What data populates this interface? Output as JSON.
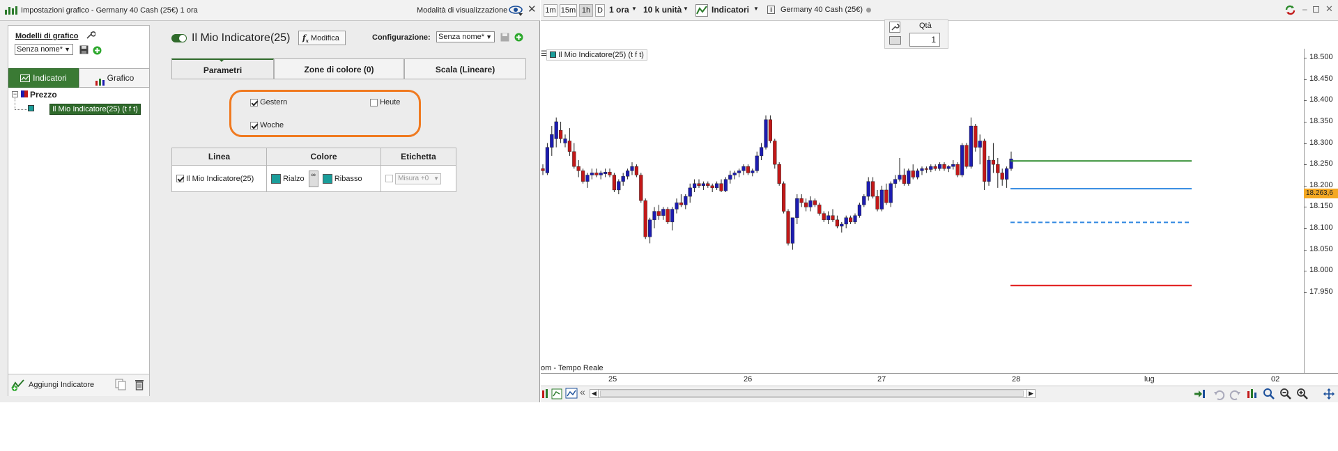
{
  "dialog": {
    "title": "Impostazioni grafico - Germany 40 Cash (25€) 1 ora",
    "view_mode_label": "Modalità di visualizzazione",
    "chart_models_label": "Modelli di grafico",
    "model_select_value": "Senza nome*",
    "left_tabs": {
      "indicators": "Indicatori",
      "chart": "Grafico"
    },
    "tree": {
      "root": "Prezzo",
      "child": "Il Mio Indicatore(25) (t f t)"
    },
    "add_indicator_label": "Aggiungi Indicatore",
    "indicator_title": "Il Mio Indicatore(25)",
    "edit_label": "Modifica",
    "configuration_label": "Configurazione:",
    "configuration_value": "Senza nome*",
    "param_tabs": [
      "Parametri",
      "Zone di colore (0)",
      "Scala (Lineare)"
    ],
    "params": [
      {
        "label": "Gestern",
        "checked": true
      },
      {
        "label": "Heute",
        "checked": false
      },
      {
        "label": "Woche",
        "checked": true
      }
    ],
    "line_table": {
      "headers": [
        "Linea",
        "Colore",
        "Etichetta"
      ],
      "row": {
        "line_label": "Il Mio Indicatore(25)",
        "line_checked": true,
        "up_label": "Rialzo",
        "down_label": "Ribasso",
        "label_select": "Misura +0",
        "label_checked": false
      }
    },
    "highlight_color": "#f07a20"
  },
  "chart": {
    "timeframes": [
      "1m",
      "15m",
      "1h",
      "D"
    ],
    "selected_timeframe": "1h",
    "period_label": "1 ora",
    "units_label": "10 k unità",
    "indicators_label": "Indicatori",
    "instrument": "Germany 40 Cash (25€)",
    "qty_label": "Qtà",
    "qty_value": "1",
    "legend_label": "Il Mio Indicatore(25) (t f t)",
    "source_text": "om - Tempo Reale",
    "price_labels": [
      "18.500",
      "18.450",
      "18.400",
      "18.350",
      "18.300",
      "18.250",
      "18.200",
      "18.150",
      "18.100",
      "18.050",
      "18.000",
      "17.950"
    ],
    "current_price": "18.263,6",
    "date_labels": [
      "25",
      "26",
      "27",
      "28",
      "lug",
      "02"
    ],
    "colors": {
      "up": "#1c1cb0",
      "down": "#c21818",
      "level_green": "#2e8b2e",
      "level_blue": "#2d86e0",
      "level_red": "#e01515",
      "price_tag": "#f4a823"
    }
  },
  "chart_data": {
    "type": "candlestick",
    "title": "",
    "xlabel": "",
    "ylabel": "",
    "ylim": [
      17930,
      18520
    ],
    "candles": [
      [
        18240,
        18250,
        18225,
        18235
      ],
      [
        18230,
        18300,
        18225,
        18290
      ],
      [
        18290,
        18340,
        18270,
        18320
      ],
      [
        18310,
        18360,
        18290,
        18350
      ],
      [
        18330,
        18350,
        18300,
        18310
      ],
      [
        18300,
        18320,
        18290,
        18310
      ],
      [
        18305,
        18335,
        18270,
        18280
      ],
      [
        18280,
        18300,
        18240,
        18245
      ],
      [
        18245,
        18260,
        18220,
        18235
      ],
      [
        18235,
        18240,
        18205,
        18210
      ],
      [
        18210,
        18230,
        18195,
        18225
      ],
      [
        18225,
        18240,
        18215,
        18230
      ],
      [
        18230,
        18240,
        18220,
        18225
      ],
      [
        18225,
        18235,
        18215,
        18230
      ],
      [
        18228,
        18240,
        18220,
        18232
      ],
      [
        18232,
        18240,
        18220,
        18225
      ],
      [
        18225,
        18230,
        18185,
        18190
      ],
      [
        18190,
        18215,
        18180,
        18210
      ],
      [
        18210,
        18230,
        18200,
        18222
      ],
      [
        18222,
        18240,
        18215,
        18235
      ],
      [
        18235,
        18255,
        18225,
        18245
      ],
      [
        18245,
        18250,
        18220,
        18225
      ],
      [
        18225,
        18230,
        18160,
        18165
      ],
      [
        18165,
        18170,
        18075,
        18080
      ],
      [
        18080,
        18125,
        18065,
        18120
      ],
      [
        18120,
        18150,
        18100,
        18140
      ],
      [
        18140,
        18155,
        18120,
        18130
      ],
      [
        18130,
        18150,
        18120,
        18145
      ],
      [
        18145,
        18150,
        18110,
        18115
      ],
      [
        18115,
        18150,
        18095,
        18145
      ],
      [
        18145,
        18170,
        18135,
        18160
      ],
      [
        18160,
        18180,
        18150,
        18155
      ],
      [
        18155,
        18180,
        18145,
        18175
      ],
      [
        18175,
        18205,
        18160,
        18195
      ],
      [
        18195,
        18215,
        18185,
        18205
      ],
      [
        18205,
        18215,
        18195,
        18200
      ],
      [
        18200,
        18210,
        18190,
        18205
      ],
      [
        18205,
        18210,
        18195,
        18200
      ],
      [
        18200,
        18205,
        18185,
        18195
      ],
      [
        18195,
        18210,
        18190,
        18205
      ],
      [
        18205,
        18215,
        18185,
        18188
      ],
      [
        18188,
        18220,
        18185,
        18215
      ],
      [
        18215,
        18235,
        18205,
        18225
      ],
      [
        18225,
        18235,
        18215,
        18230
      ],
      [
        18230,
        18240,
        18220,
        18235
      ],
      [
        18235,
        18250,
        18225,
        18245
      ],
      [
        18245,
        18250,
        18225,
        18230
      ],
      [
        18230,
        18240,
        18222,
        18235
      ],
      [
        18235,
        18280,
        18230,
        18270
      ],
      [
        18270,
        18300,
        18260,
        18290
      ],
      [
        18290,
        18365,
        18285,
        18355
      ],
      [
        18355,
        18365,
        18300,
        18305
      ],
      [
        18305,
        18310,
        18240,
        18250
      ],
      [
        18250,
        18255,
        18200,
        18205
      ],
      [
        18205,
        18210,
        18135,
        18140
      ],
      [
        18140,
        18145,
        18060,
        18065
      ],
      [
        18065,
        18080,
        18050,
        18125
      ],
      [
        18125,
        18180,
        18110,
        18170
      ],
      [
        18170,
        18180,
        18150,
        18160
      ],
      [
        18160,
        18170,
        18140,
        18150
      ],
      [
        18150,
        18175,
        18140,
        18165
      ],
      [
        18165,
        18170,
        18150,
        18155
      ],
      [
        18155,
        18160,
        18130,
        18135
      ],
      [
        18135,
        18140,
        18115,
        18120
      ],
      [
        18120,
        18140,
        18110,
        18130
      ],
      [
        18130,
        18145,
        18115,
        18120
      ],
      [
        18120,
        18130,
        18100,
        18105
      ],
      [
        18105,
        18115,
        18090,
        18110
      ],
      [
        18110,
        18130,
        18100,
        18125
      ],
      [
        18125,
        18130,
        18110,
        18115
      ],
      [
        18115,
        18135,
        18110,
        18130
      ],
      [
        18130,
        18160,
        18125,
        18155
      ],
      [
        18155,
        18180,
        18150,
        18175
      ],
      [
        18175,
        18220,
        18165,
        18210
      ],
      [
        18210,
        18220,
        18170,
        18175
      ],
      [
        18175,
        18190,
        18140,
        18145
      ],
      [
        18145,
        18200,
        18140,
        18190
      ],
      [
        18190,
        18205,
        18155,
        18160
      ],
      [
        18160,
        18210,
        18150,
        18205
      ],
      [
        18205,
        18225,
        18195,
        18215
      ],
      [
        18215,
        18265,
        18210,
        18225
      ],
      [
        18225,
        18240,
        18200,
        18205
      ],
      [
        18205,
        18240,
        18200,
        18235
      ],
      [
        18235,
        18250,
        18215,
        18220
      ],
      [
        18220,
        18240,
        18215,
        18235
      ],
      [
        18235,
        18245,
        18225,
        18240
      ],
      [
        18240,
        18245,
        18230,
        18238
      ],
      [
        18238,
        18250,
        18232,
        18245
      ],
      [
        18245,
        18250,
        18235,
        18240
      ],
      [
        18240,
        18255,
        18235,
        18250
      ],
      [
        18250,
        18255,
        18235,
        18240
      ],
      [
        18240,
        18248,
        18232,
        18245
      ],
      [
        18245,
        18260,
        18238,
        18250
      ],
      [
        18250,
        18255,
        18220,
        18225
      ],
      [
        18225,
        18300,
        18220,
        18295
      ],
      [
        18295,
        18300,
        18240,
        18245
      ],
      [
        18245,
        18360,
        18240,
        18340
      ],
      [
        18340,
        18345,
        18280,
        18290
      ],
      [
        18290,
        18320,
        18250,
        18305
      ],
      [
        18305,
        18310,
        18190,
        18210
      ],
      [
        18210,
        18270,
        18200,
        18260
      ],
      [
        18260,
        18300,
        18230,
        18250
      ],
      [
        18250,
        18265,
        18195,
        18230
      ],
      [
        18230,
        18240,
        18200,
        18215
      ],
      [
        18215,
        18245,
        18195,
        18240
      ],
      [
        18240,
        18280,
        18235,
        18263
      ]
    ],
    "levels": [
      {
        "color": "green",
        "value": 18258,
        "style": "solid"
      },
      {
        "color": "blue",
        "value": 18193,
        "style": "solid"
      },
      {
        "color": "blue",
        "value": 18114,
        "style": "dashed"
      },
      {
        "color": "red",
        "value": 17966,
        "style": "solid"
      }
    ]
  }
}
